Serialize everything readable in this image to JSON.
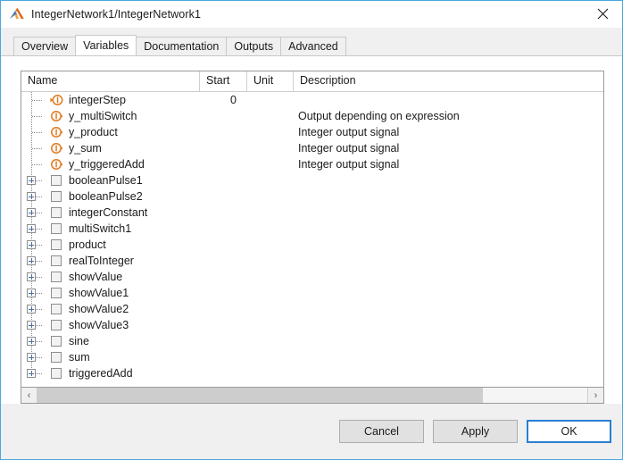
{
  "window": {
    "title": "IntegerNetwork1/IntegerNetwork1",
    "app_icon": "matlab-membrane-icon",
    "close_label": "×",
    "accent_color": "#4aa8e0"
  },
  "tabs": [
    {
      "label": "Overview",
      "selected": false
    },
    {
      "label": "Variables",
      "selected": true
    },
    {
      "label": "Documentation",
      "selected": false
    },
    {
      "label": "Outputs",
      "selected": false
    },
    {
      "label": "Advanced",
      "selected": false
    }
  ],
  "table": {
    "columns": [
      {
        "key": "name",
        "label": "Name"
      },
      {
        "key": "start",
        "label": "Start"
      },
      {
        "key": "unit",
        "label": "Unit"
      },
      {
        "key": "desc",
        "label": "Description"
      }
    ],
    "rows": [
      {
        "name": "integerStep",
        "start": "0",
        "unit": "",
        "desc": "",
        "type": "variable",
        "icon": "output-variable-icon",
        "expandable": false
      },
      {
        "name": "y_multiSwitch",
        "start": "",
        "unit": "",
        "desc": "Output depending on expression",
        "type": "variable",
        "icon": "output-variable-icon",
        "expandable": false
      },
      {
        "name": "y_product",
        "start": "",
        "unit": "",
        "desc": "Integer output signal",
        "type": "variable",
        "icon": "output-variable-icon",
        "expandable": false
      },
      {
        "name": "y_sum",
        "start": "",
        "unit": "",
        "desc": "Integer output signal",
        "type": "variable",
        "icon": "output-variable-icon",
        "expandable": false
      },
      {
        "name": "y_triggeredAdd",
        "start": "",
        "unit": "",
        "desc": "Integer output signal",
        "type": "variable",
        "icon": "output-variable-icon",
        "expandable": false
      },
      {
        "name": "booleanPulse1",
        "start": "",
        "unit": "",
        "desc": "",
        "type": "component",
        "icon": "component-block-icon",
        "expandable": true
      },
      {
        "name": "booleanPulse2",
        "start": "",
        "unit": "",
        "desc": "",
        "type": "component",
        "icon": "component-block-icon",
        "expandable": true
      },
      {
        "name": "integerConstant",
        "start": "",
        "unit": "",
        "desc": "",
        "type": "component",
        "icon": "component-block-icon",
        "expandable": true
      },
      {
        "name": "multiSwitch1",
        "start": "",
        "unit": "",
        "desc": "",
        "type": "component",
        "icon": "component-block-icon",
        "expandable": true
      },
      {
        "name": "product",
        "start": "",
        "unit": "",
        "desc": "",
        "type": "component",
        "icon": "component-block-icon",
        "expandable": true
      },
      {
        "name": "realToInteger",
        "start": "",
        "unit": "",
        "desc": "",
        "type": "component",
        "icon": "component-block-icon",
        "expandable": true
      },
      {
        "name": "showValue",
        "start": "",
        "unit": "",
        "desc": "",
        "type": "component",
        "icon": "component-block-icon",
        "expandable": true
      },
      {
        "name": "showValue1",
        "start": "",
        "unit": "",
        "desc": "",
        "type": "component",
        "icon": "component-block-icon",
        "expandable": true
      },
      {
        "name": "showValue2",
        "start": "",
        "unit": "",
        "desc": "",
        "type": "component",
        "icon": "component-block-icon",
        "expandable": true
      },
      {
        "name": "showValue3",
        "start": "",
        "unit": "",
        "desc": "",
        "type": "component",
        "icon": "component-block-icon",
        "expandable": true
      },
      {
        "name": "sine",
        "start": "",
        "unit": "",
        "desc": "",
        "type": "component",
        "icon": "component-block-icon",
        "expandable": true
      },
      {
        "name": "sum",
        "start": "",
        "unit": "",
        "desc": "",
        "type": "component",
        "icon": "component-block-icon",
        "expandable": true
      },
      {
        "name": "triggeredAdd",
        "start": "",
        "unit": "",
        "desc": "",
        "type": "component",
        "icon": "component-block-icon",
        "expandable": true
      }
    ]
  },
  "scrollbar": {
    "left_arrow": "‹",
    "right_arrow": "›",
    "thumb_percent": 81
  },
  "footer": {
    "cancel_label": "Cancel",
    "apply_label": "Apply",
    "ok_label": "OK"
  }
}
